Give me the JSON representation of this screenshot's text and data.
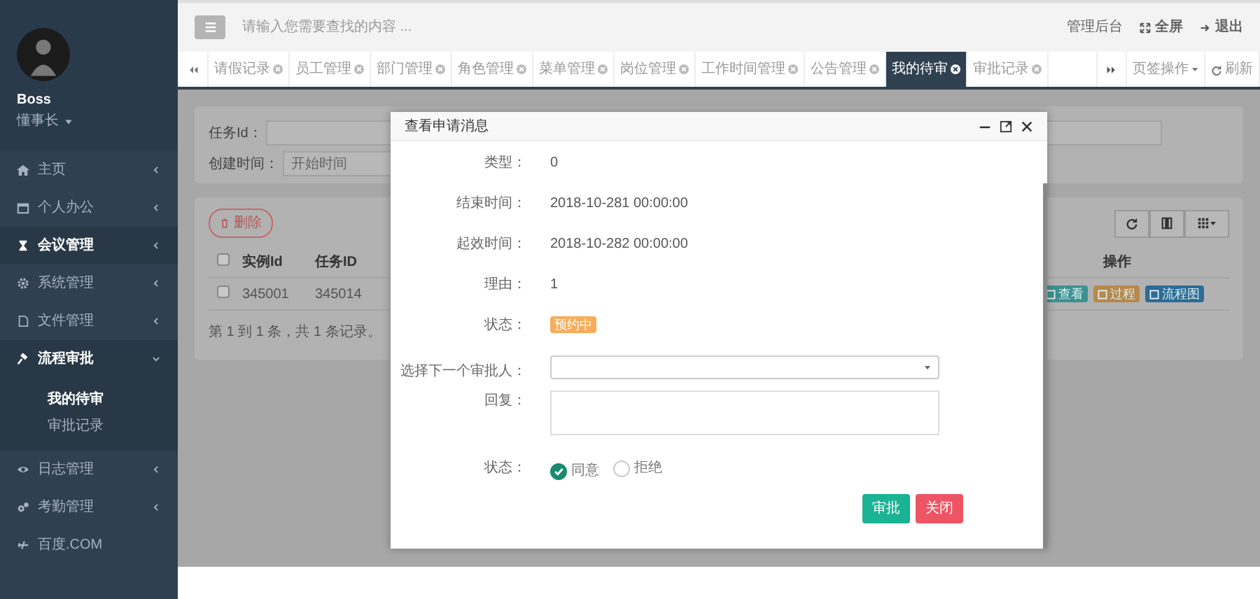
{
  "sidebar": {
    "user": {
      "name": "Boss",
      "role": "懂事长"
    },
    "menu": [
      {
        "label": "主页",
        "selected": false,
        "expanded": false
      },
      {
        "label": "个人办公",
        "selected": false,
        "expanded": false
      },
      {
        "label": "会议管理",
        "selected": true,
        "expanded": false
      },
      {
        "label": "系统管理",
        "selected": false,
        "expanded": false
      },
      {
        "label": "文件管理",
        "selected": false,
        "expanded": false
      },
      {
        "label": "流程审批",
        "expanded": true,
        "children": [
          {
            "label": "我的待审",
            "selected": true
          },
          {
            "label": "审批记录",
            "selected": false
          }
        ]
      },
      {
        "label": "日志管理",
        "selected": false,
        "expanded": false
      },
      {
        "label": "考勤管理",
        "selected": false,
        "expanded": false
      },
      {
        "label": "百度.COM",
        "selected": false
      }
    ]
  },
  "topbar": {
    "search": {
      "placeholder": "请输入您需要查找的内容 ..."
    },
    "links": [
      {
        "label": "管理后台",
        "kind": "text"
      },
      {
        "label": "全屏",
        "kind": "fullscreen"
      },
      {
        "label": "退出",
        "kind": "logout"
      }
    ]
  },
  "tabs": [
    {
      "label": "请假记录",
      "selected": false
    },
    {
      "label": "员工管理",
      "selected": false
    },
    {
      "label": "部门管理",
      "selected": false
    },
    {
      "label": "角色管理",
      "selected": false
    },
    {
      "label": "菜单管理",
      "selected": false
    },
    {
      "label": "岗位管理",
      "selected": false
    },
    {
      "label": "工作时间管理",
      "selected": false
    },
    {
      "label": "公告管理",
      "selected": false
    },
    {
      "label": "我的待审",
      "selected": true
    },
    {
      "label": "审批记录",
      "selected": false
    }
  ],
  "tab_controls": {
    "menu": "页签操作",
    "refresh": "刷新"
  },
  "search_form": {
    "fields": [
      {
        "label": "任务Id："
      },
      {
        "label": "创建时间：",
        "placeholder": "开始时间"
      }
    ]
  },
  "table": {
    "delete_button": "删除",
    "columns": [
      "实例Id",
      "任务ID",
      "操作"
    ],
    "header_checked": false,
    "rows": [
      {
        "checked": false,
        "cells": [
          "345001",
          "345014"
        ],
        "actions": [
          {
            "label": "查看",
            "color": "#3d9090"
          },
          {
            "label": "过程",
            "color": "#b58a4c"
          },
          {
            "label": "流程图",
            "color": "#2d6c96"
          }
        ]
      }
    ],
    "footer": "第 1 到 1 条，共 1 条记录。"
  },
  "modal": {
    "title": "查看申请消息",
    "fields": [
      {
        "label": "类型：",
        "kind": "text",
        "value": "0"
      },
      {
        "label": "结束时间：",
        "kind": "text",
        "value": "2018-10-281 00:00:00"
      },
      {
        "label": "起效时间：",
        "kind": "text",
        "value": "2018-10-282 00:00:00"
      },
      {
        "label": "理由：",
        "kind": "text",
        "value": "1"
      },
      {
        "label": "状态：",
        "kind": "badge",
        "value": "预约中"
      },
      {
        "label": "选择下一个审批人：",
        "kind": "select"
      },
      {
        "label": "回复：",
        "kind": "textarea"
      },
      {
        "label": "状态：",
        "kind": "radio",
        "options": [
          {
            "label": "同意",
            "selected": true
          },
          {
            "label": "拒绝",
            "selected": false
          }
        ]
      }
    ],
    "buttons": [
      {
        "label": "审批",
        "kind": "primary"
      },
      {
        "label": "关闭",
        "kind": "danger"
      }
    ]
  }
}
